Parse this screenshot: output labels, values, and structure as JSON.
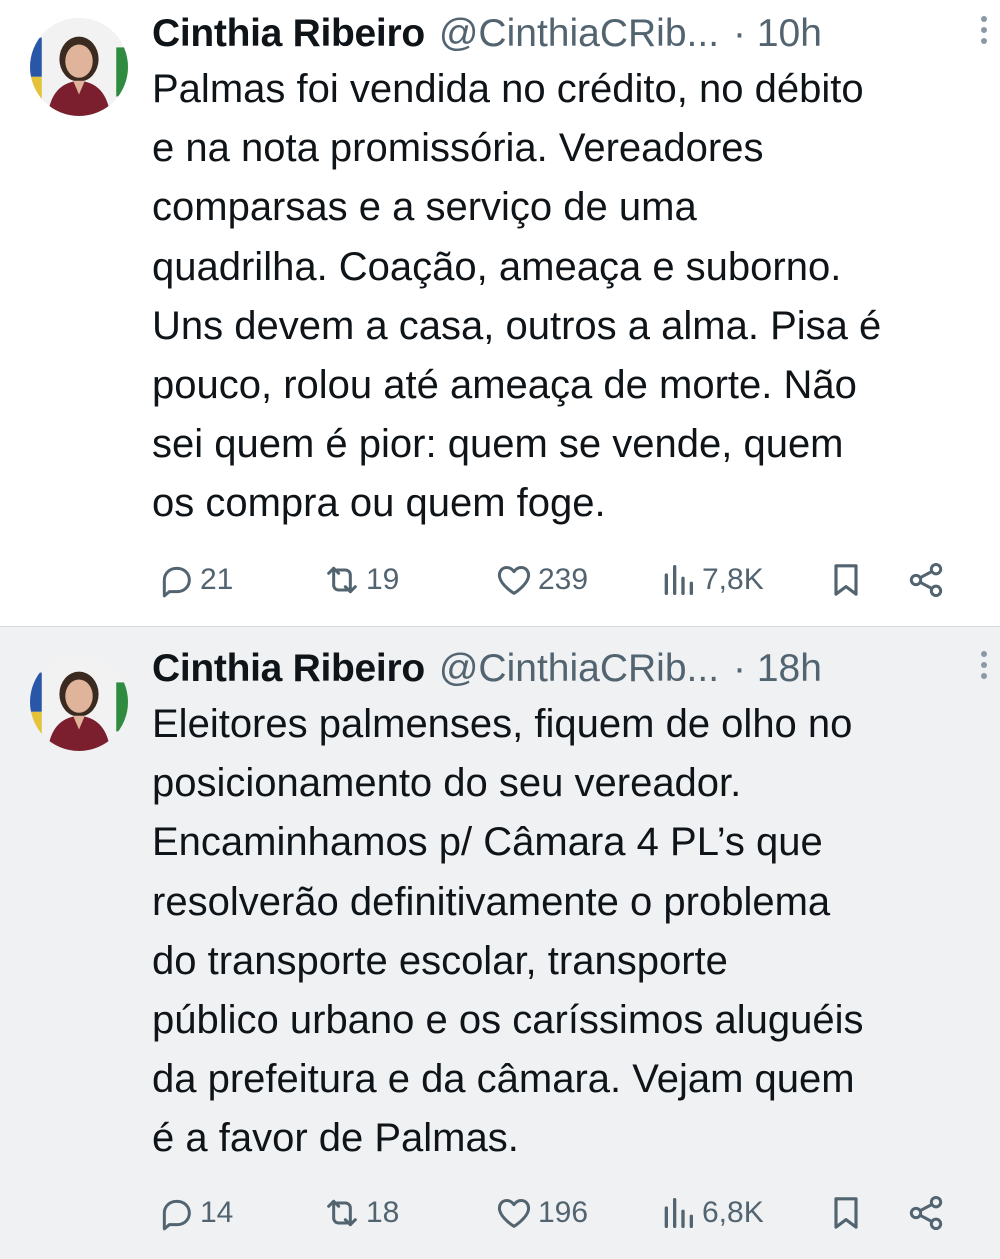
{
  "tweets": [
    {
      "name": "Cinthia Ribeiro",
      "handle": "@CinthiaCRib...",
      "time": "· 10h",
      "text": "Palmas foi vendida no crédito, no débito\ne na nota promissória. Vereadores\ncomparsas e a serviço de uma\nquadrilha. Coação, ameaça e suborno.\nUns devem a casa, outros a alma. Pisa é\npouco, rolou até ameaça de morte. Não\nsei quem é pior: quem se vende, quem\nos compra ou quem foge.",
      "replies": "21",
      "reposts": "19",
      "likes": "239",
      "views": "7,8K"
    },
    {
      "name": "Cinthia Ribeiro",
      "handle": "@CinthiaCRib...",
      "time": "· 18h",
      "text": "Eleitores palmenses, fiquem de olho no\nposicionamento do seu vereador.\nEncaminhamos p/ Câmara 4 PL’s que\nresolverão definitivamente o problema\ndo transporte escolar, transporte\npúblico urbano e os caríssimos aluguéis\nda prefeitura e da câmara. Vejam quem\né a favor de Palmas.",
      "replies": "14",
      "reposts": "18",
      "likes": "196",
      "views": "6,8K"
    }
  ],
  "icons": {
    "reply": "reply-icon",
    "repost": "repost-icon",
    "like": "heart-icon",
    "views": "views-icon",
    "bookmark": "bookmark-icon",
    "share": "share-icon",
    "more": "more-icon"
  },
  "colors": {
    "text": "#0f1419",
    "secondary": "#536471",
    "tweet_bg_1": "#ffffff",
    "tweet_bg_2": "#eff1f3"
  }
}
